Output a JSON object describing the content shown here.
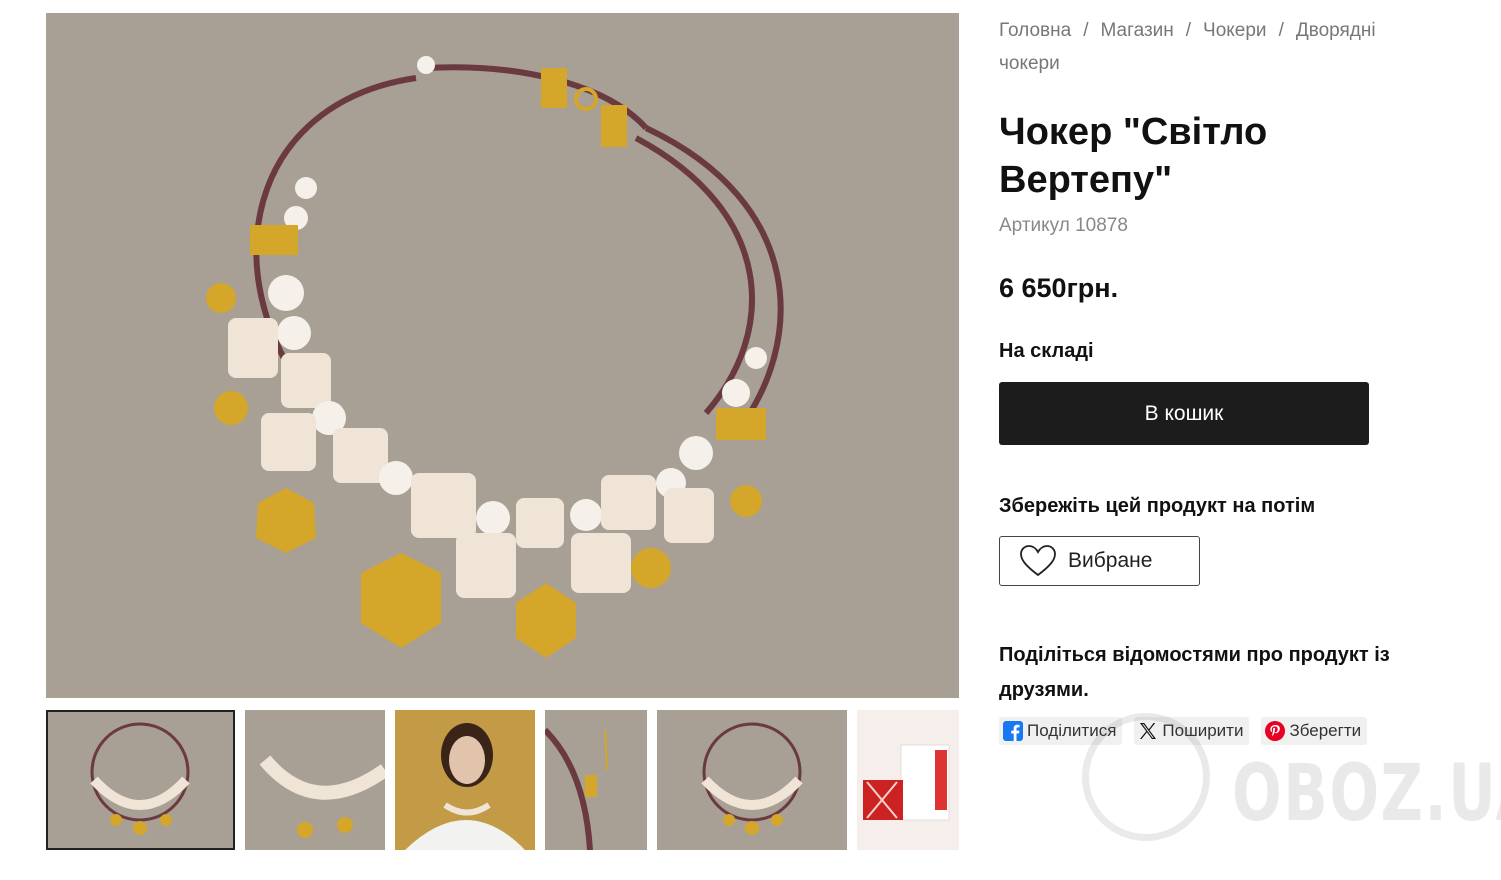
{
  "breadcrumb": {
    "items": [
      "Головна",
      "Магазин",
      "Чокери",
      "Дворядні чокери"
    ],
    "separator": "/"
  },
  "product": {
    "title": "Чокер \"Світло Вертепу\"",
    "sku": "Артикул 10878",
    "price": "6 650грн.",
    "stock": "На складі",
    "add_to_cart": "В кошик",
    "save_heading": "Збережіть цей продукт на потім",
    "favorite_label": "Вибране",
    "share_heading": "Поділіться відомостями про продукт із друзями."
  },
  "share": {
    "facebook": "Поділитися",
    "x": "Поширити",
    "pinterest": "Зберегти"
  },
  "watermark": {
    "text": "OBOZ.UA"
  },
  "gallery": {
    "main_image": "necklace-photo",
    "thumbnails": [
      "necklace-front",
      "necklace-closeup",
      "model-wearing",
      "clasp-detail",
      "necklace-front-2",
      "gift-packaging"
    ],
    "active_index": 0
  },
  "icons": {
    "favorite": "heart-icon",
    "facebook": "facebook-icon",
    "x": "x-icon",
    "pinterest": "pinterest-icon"
  },
  "colors": {
    "button_bg": "#1c1c1c",
    "photo_bg": "#a89f95",
    "gold": "#d4a62a",
    "muted_text": "#777777"
  }
}
